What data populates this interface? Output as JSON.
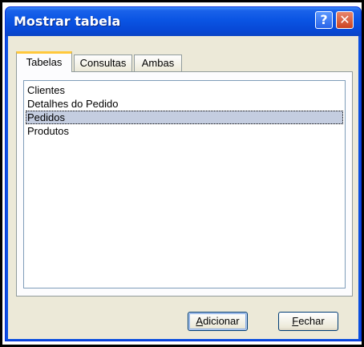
{
  "window": {
    "title": "Mostrar tabela",
    "help_glyph": "?",
    "close_glyph": "✕"
  },
  "tabs": [
    {
      "label": "Tabelas",
      "active": true
    },
    {
      "label": "Consultas",
      "active": false
    },
    {
      "label": "Ambas",
      "active": false
    }
  ],
  "list": {
    "items": [
      "Clientes",
      "Detalhes do Pedido",
      "Pedidos",
      "Produtos"
    ],
    "selected_index": 2
  },
  "buttons": {
    "add": {
      "mnemonic": "A",
      "rest": "dicionar"
    },
    "close": {
      "mnemonic": "F",
      "rest": "echar"
    }
  },
  "colors": {
    "titlebar": "#0a54e3",
    "selection": "#c4cde0",
    "active_tab_accent": "#ffc83c"
  }
}
